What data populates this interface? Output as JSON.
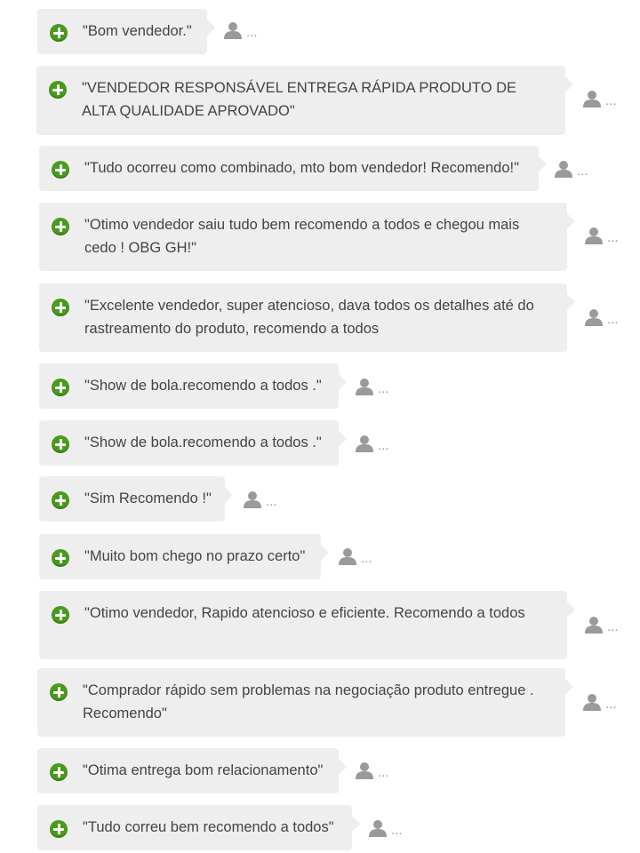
{
  "theme": {
    "bubble_color": "#eeeeee",
    "accent_color": "#4a9a1e",
    "icon_color": "#9a9a9a",
    "text_color": "#444444"
  },
  "feedback": [
    {
      "text": "\"Bom vendedor.\"",
      "meta": "...",
      "icon": "plus-circle-icon",
      "user_icon": "user-icon"
    },
    {
      "text": "\"VENDEDOR RESPONSÁVEL ENTREGA RÁPIDA PRODUTO DE\nALTA QUALIDADE APROVADO\"",
      "meta": "...",
      "icon": "plus-circle-icon",
      "user_icon": "user-icon"
    },
    {
      "text": "\"Tudo ocorreu como combinado, mto bom vendedor! Recomendo!\"",
      "meta": "...",
      "icon": "plus-circle-icon",
      "user_icon": "user-icon"
    },
    {
      "text": "\"Otimo vendedor saiu tudo bem recomendo a todos e chegou mais\ncedo ! OBG GH!\"",
      "meta": "...",
      "icon": "plus-circle-icon",
      "user_icon": "user-icon"
    },
    {
      "text": "\"Excelente vendedor, super atencioso, dava todos os detalhes até do\nrastreamento do produto, recomendo a todos",
      "meta": "...",
      "icon": "plus-circle-icon",
      "user_icon": "user-icon"
    },
    {
      "text": "\"Show de bola.recomendo a todos .\"",
      "meta": "...",
      "icon": "plus-circle-icon",
      "user_icon": "user-icon"
    },
    {
      "text": "\"Show de bola.recomendo a todos .\"",
      "meta": "...",
      "icon": "plus-circle-icon",
      "user_icon": "user-icon"
    },
    {
      "text": "\"Sim Recomendo !\"",
      "meta": "...",
      "icon": "plus-circle-icon",
      "user_icon": "user-icon"
    },
    {
      "text": "\"Muito bom chego no prazo certo\"",
      "meta": "...",
      "icon": "plus-circle-icon",
      "user_icon": "user-icon"
    },
    {
      "text": "\"Otimo vendedor, Rapido atencioso e eficiente. Recomendo a todos",
      "meta": "...",
      "icon": "plus-circle-icon",
      "user_icon": "user-icon"
    },
    {
      "text": "\"Comprador rápido sem problemas na negociação produto entregue .\nRecomendo\"",
      "meta": "...",
      "icon": "plus-circle-icon",
      "user_icon": "user-icon"
    },
    {
      "text": "\"Otima entrega bom relacionamento\"",
      "meta": "...",
      "icon": "plus-circle-icon",
      "user_icon": "user-icon"
    },
    {
      "text": "\"Tudo correu bem recomendo a todos\"",
      "meta": "...",
      "icon": "plus-circle-icon",
      "user_icon": "user-icon"
    }
  ]
}
